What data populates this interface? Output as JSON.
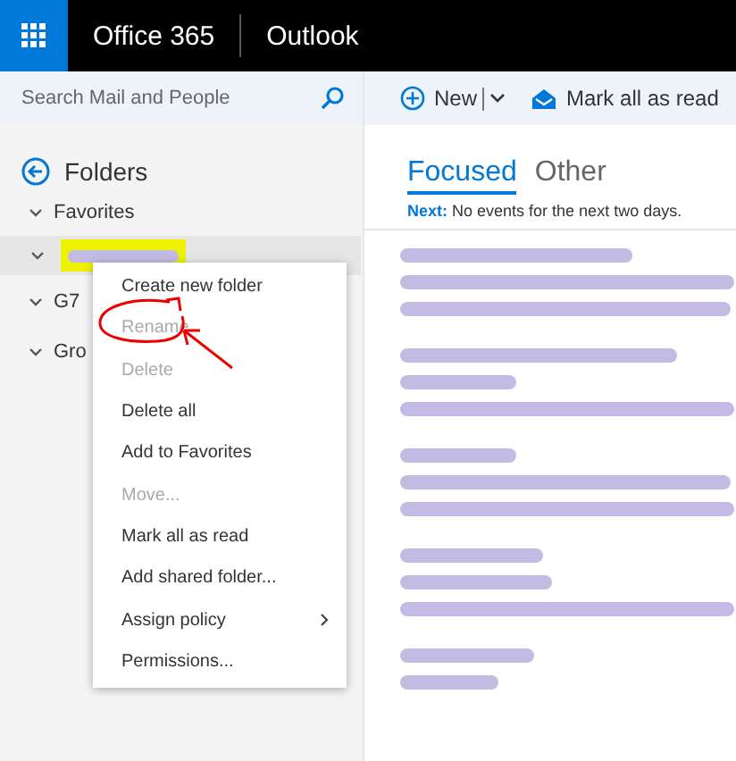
{
  "header": {
    "suite": "Office 365",
    "app": "Outlook"
  },
  "search": {
    "placeholder": "Search Mail and People"
  },
  "toolbar": {
    "new_label": "New",
    "mark_read_label": "Mark all as read"
  },
  "folders": {
    "title": "Folders",
    "groups": [
      {
        "label": "Favorites",
        "expanded": true,
        "children": [
          {
            "redacted": true,
            "highlighted": true,
            "selected": true
          }
        ]
      },
      {
        "label": "G7",
        "expanded": true
      },
      {
        "label": "Gro",
        "expanded": true
      }
    ]
  },
  "tabs": [
    {
      "label": "Focused",
      "selected": true
    },
    {
      "label": "Other",
      "selected": false
    }
  ],
  "next_events": {
    "prefix": "Next:",
    "text": "No events for the next two days."
  },
  "messages": [
    {
      "kind": "redacted"
    },
    {
      "kind": "redacted"
    },
    {
      "kind": "redacted"
    },
    {
      "kind": "redacted"
    },
    {
      "kind": "redacted"
    }
  ],
  "context_menu": {
    "items": [
      {
        "label": "Create new folder",
        "disabled": false,
        "submenu": false
      },
      {
        "label": "Rename",
        "disabled": true,
        "submenu": false,
        "circled": true
      },
      {
        "label": "Delete",
        "disabled": true,
        "submenu": false
      },
      {
        "label": "Delete all",
        "disabled": false,
        "submenu": false
      },
      {
        "label": "Add to Favorites",
        "disabled": false,
        "submenu": false
      },
      {
        "label": "Move...",
        "disabled": true,
        "submenu": false
      },
      {
        "label": "Mark all as read",
        "disabled": false,
        "submenu": false
      },
      {
        "label": "Add shared folder...",
        "disabled": false,
        "submenu": false
      },
      {
        "label": "Assign policy",
        "disabled": false,
        "submenu": true
      },
      {
        "label": "Permissions...",
        "disabled": false,
        "submenu": false
      }
    ]
  }
}
